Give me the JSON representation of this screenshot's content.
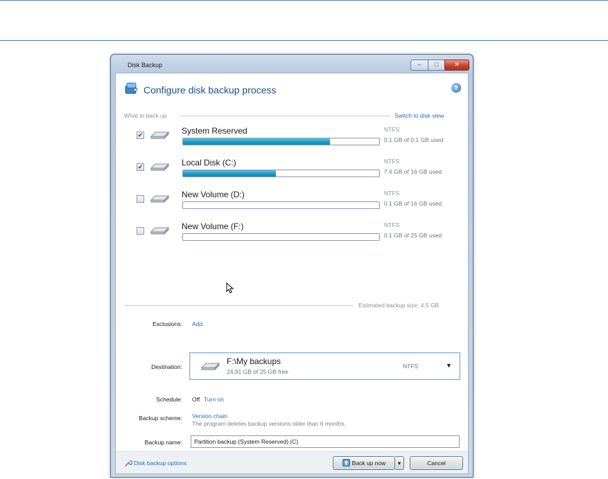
{
  "window": {
    "title": "Disk Backup",
    "controls": {
      "minimize": "–",
      "maximize": "□",
      "close": "✕"
    }
  },
  "header": {
    "title": "Configure disk backup process",
    "help": "?"
  },
  "what_to_back_up": {
    "label": "What to back up",
    "switch_link": "Switch to disk view",
    "volumes": [
      {
        "name": "System Reserved",
        "fs": "NTFS",
        "usage": "0.1 GB of 0.1 GB used",
        "checked": true,
        "check": "✔",
        "fill": 0.75
      },
      {
        "name": "Local Disk (C:)",
        "fs": "NTFS",
        "usage": "7.6 GB of 16 GB used",
        "checked": true,
        "check": "✔",
        "fill": 0.475
      },
      {
        "name": "New Volume (D:)",
        "fs": "NTFS",
        "usage": "0.1 GB of 16 GB used",
        "checked": false,
        "check": "",
        "fill": 0.0
      },
      {
        "name": "New Volume (F:)",
        "fs": "NTFS",
        "usage": "0.1 GB of 25 GB used",
        "checked": false,
        "check": "",
        "fill": 0.0
      }
    ]
  },
  "estimated": "Estimated backup size: 4.5 GB",
  "exclusions": {
    "label": "Exclusions:",
    "link": "Add"
  },
  "destination": {
    "label": "Destination:",
    "path": "F:\\My backups",
    "free": "24.91 GB of 25 GB free",
    "fs": "NTFS",
    "arrow": "▼"
  },
  "schedule": {
    "label": "Schedule:",
    "state": "Off",
    "link": "Turn on"
  },
  "backup_scheme": {
    "label": "Backup scheme:",
    "link": "Version chain",
    "note": "The program deletes backup versions older than 6 months."
  },
  "backup_name": {
    "label": "Backup name:",
    "value": "Partition backup (System Reserved) (C)"
  },
  "footer": {
    "options_link": "Disk backup options",
    "backup_button": "Back up now",
    "split_arrow": "▾",
    "cancel_button": "Cancel"
  },
  "icons": [
    "shield-backup-icon",
    "help-icon",
    "drive-icon",
    "wrench-icon",
    "upload-arrow-icon",
    "mouse-cursor-icon"
  ],
  "colors": {
    "accent": "#1f4e8c",
    "link": "#2b6cb8",
    "bar_fill": "#1c9cc8"
  }
}
